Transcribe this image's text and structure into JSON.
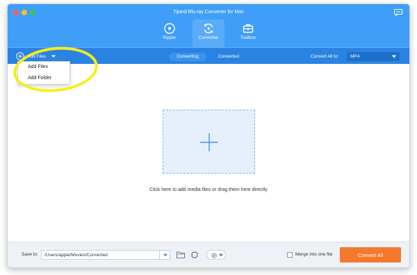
{
  "window": {
    "title": "Tipard Blu-ray Converter for Mac"
  },
  "nav": {
    "tabs": [
      {
        "label": "Ripper",
        "icon": "disc-icon"
      },
      {
        "label": "Converter",
        "icon": "converter-icon",
        "active": true
      },
      {
        "label": "Toolbox",
        "icon": "toolbox-icon"
      }
    ]
  },
  "toolbar": {
    "add_files_label": "Add Files",
    "segments": [
      "Converting",
      "Converted"
    ],
    "convert_all_label": "Convert All to:",
    "format_value": "MP4"
  },
  "dropdown": {
    "items": [
      "Add Files",
      "Add Folder"
    ]
  },
  "content": {
    "drop_hint": "Click here to add media files or drag them here directly"
  },
  "footer": {
    "save_label": "Save to:",
    "save_path": "/Users/apple/Movies/Converted",
    "merge_label": "Merge into one file",
    "merge_checked": false,
    "convert_button": "Convert All"
  },
  "colors": {
    "title_blue": "#3f9ef7",
    "toolbar_blue": "#2a83e3",
    "accent_orange": "#f5792c",
    "highlight_yellow": "#f6ef1a"
  }
}
